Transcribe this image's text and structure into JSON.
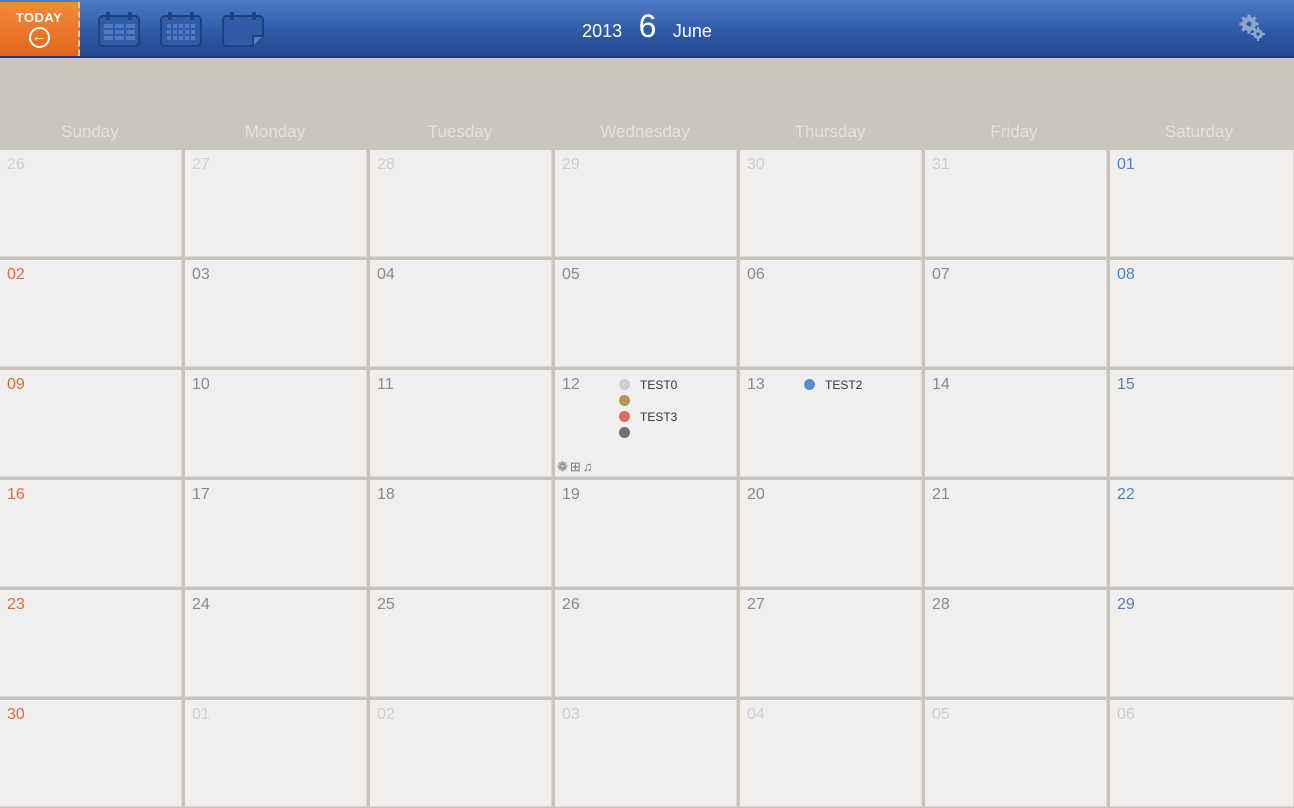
{
  "header": {
    "today_label": "TODAY",
    "year": "2013",
    "day": "6",
    "month": "June"
  },
  "colors": {
    "sunday": "#e06a3e",
    "saturday": "#4f7fc8",
    "topbar": "#2e5aa8",
    "today_button": "#e8711f"
  },
  "weekdays": [
    "Sunday",
    "Monday",
    "Tuesday",
    "Wednesday",
    "Thursday",
    "Friday",
    "Saturday"
  ],
  "weeks": [
    [
      "26",
      "27",
      "28",
      "29",
      "30",
      "31",
      "01"
    ],
    [
      "02",
      "03",
      "04",
      "05",
      "06",
      "07",
      "08"
    ],
    [
      "09",
      "10",
      "11",
      "12",
      "13",
      "14",
      "15"
    ],
    [
      "16",
      "17",
      "18",
      "19",
      "20",
      "21",
      "22"
    ],
    [
      "23",
      "24",
      "25",
      "26",
      "27",
      "28",
      "29"
    ],
    [
      "30",
      "01",
      "02",
      "03",
      "04",
      "05",
      "06"
    ]
  ],
  "out_of_month": [
    [
      true,
      true,
      true,
      true,
      true,
      true,
      false
    ],
    [
      false,
      false,
      false,
      false,
      false,
      false,
      false
    ],
    [
      false,
      false,
      false,
      false,
      false,
      false,
      false
    ],
    [
      false,
      false,
      false,
      false,
      false,
      false,
      false
    ],
    [
      false,
      false,
      false,
      false,
      false,
      false,
      false
    ],
    [
      false,
      true,
      true,
      true,
      true,
      true,
      true
    ]
  ],
  "events": [
    {
      "week": 2,
      "day": 3,
      "items": [
        {
          "label": "TEST0",
          "color": "#cfcfcf"
        },
        {
          "label": "",
          "color": "#b89456"
        },
        {
          "label": "TEST3",
          "color": "#d9705f"
        },
        {
          "label": "",
          "color": "#6e6e6e"
        }
      ],
      "icons": [
        "gift-icon",
        "plus-box-icon",
        "music-note-icon"
      ]
    },
    {
      "week": 2,
      "day": 4,
      "items": [
        {
          "label": "TEST2",
          "color": "#5a8ad1"
        }
      ],
      "icons": []
    }
  ],
  "icons": {
    "today_arrow": "arrow-left-circle-icon",
    "view1": "week-list-calendar-icon",
    "view2": "month-calendar-icon",
    "view3": "day-calendar-icon",
    "settings": "gear-icon"
  }
}
